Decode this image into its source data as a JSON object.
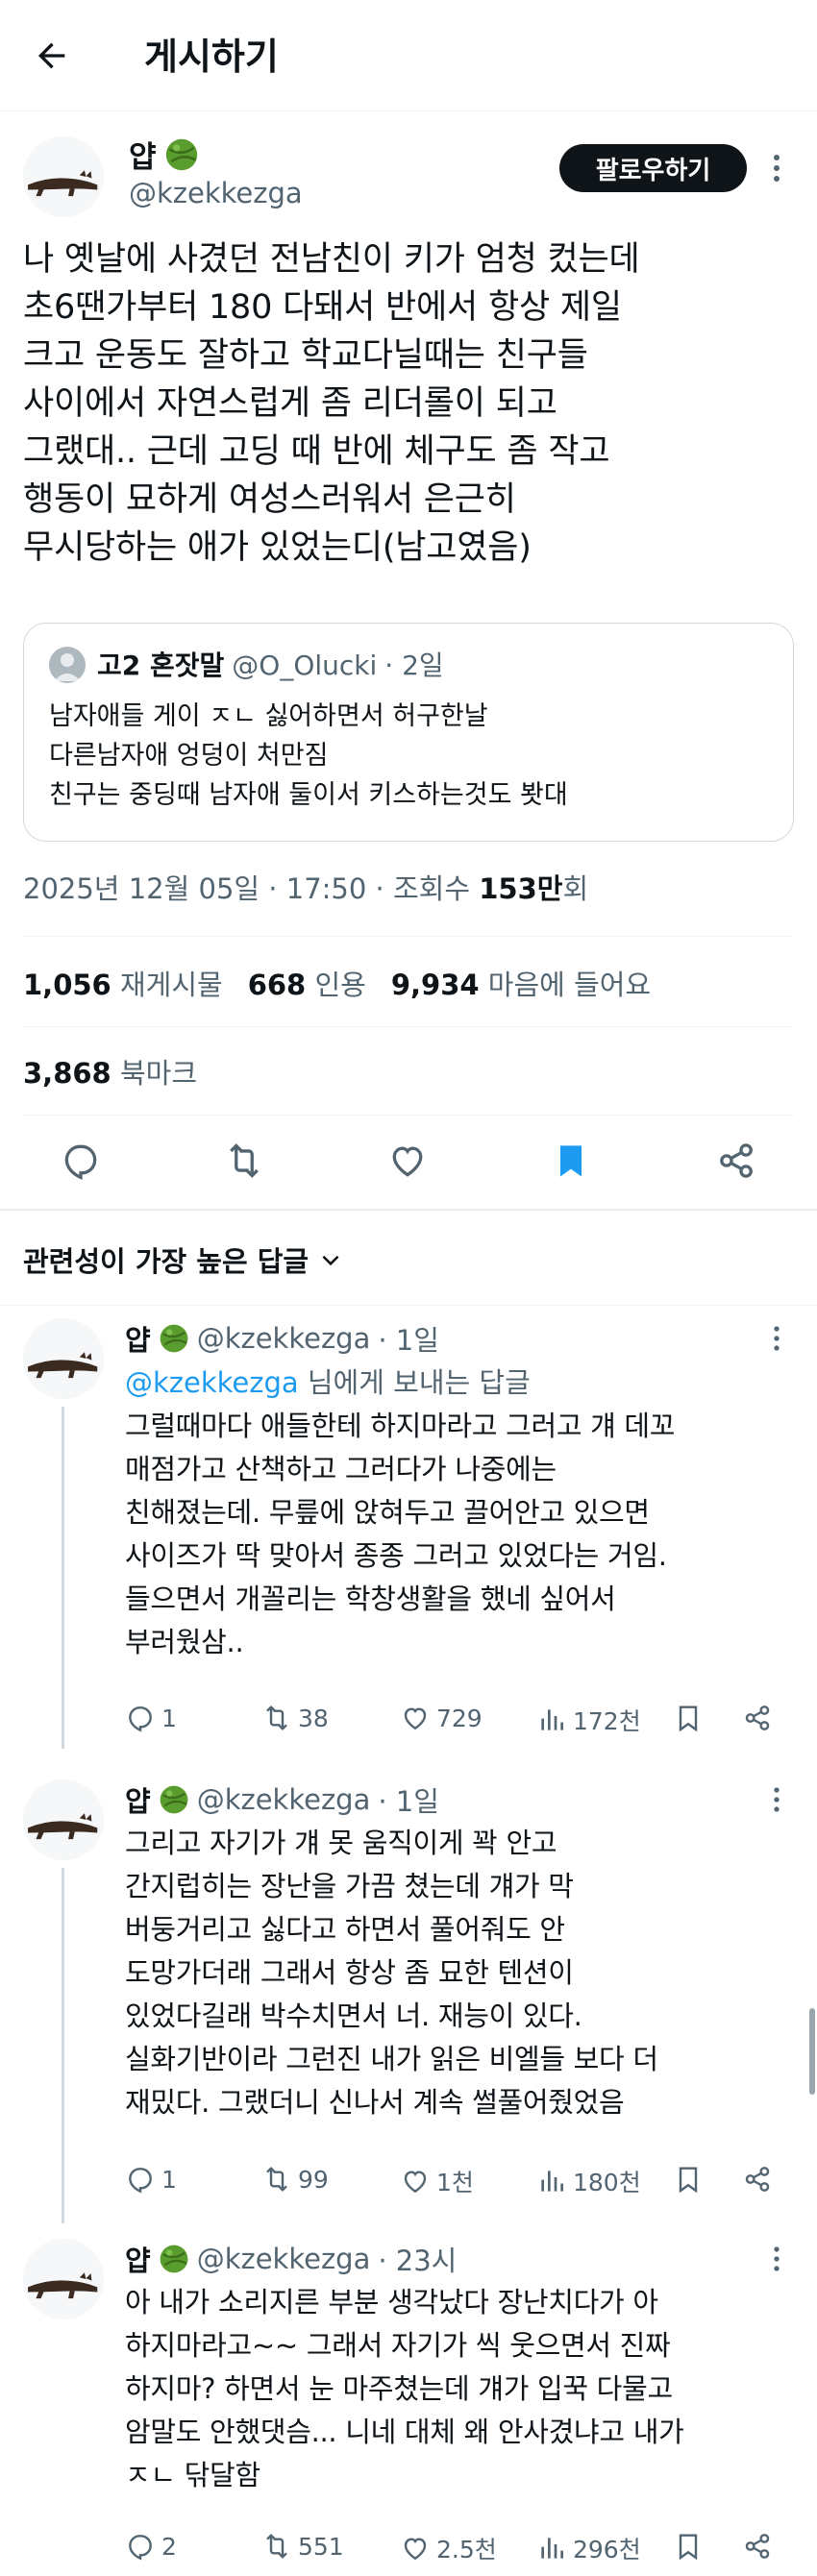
{
  "header": {
    "title": "게시하기"
  },
  "post": {
    "author": {
      "name": "얍",
      "handle": "@kzekkezga"
    },
    "follow_label": "팔로우하기",
    "text": "나 옛날에 사겼던 전남친이 키가 엄청 컸는데\n초6땐가부터 180 다돼서 반에서 항상 제일\n크고 운동도 잘하고 학교다닐때는 친구들\n사이에서 자연스럽게 좀 리더롤이 되고\n그랬대.. 근데 고딩 때 반에 체구도 좀 작고\n행동이 묘하게 여성스러워서 은근히\n무시당하는 애가 있었는디(남고였음)",
    "quote": {
      "author": "고2 혼잣말",
      "handle": "@O_Olucki",
      "time": "· 2일",
      "text": "남자애들 게이 ㅈㄴ 싫어하면서 허구한날\n다른남자애 엉덩이 처만짐\n친구는 중딩때 남자애 둘이서 키스하는것도 봣대"
    },
    "meta": {
      "datetime": "2025년 12월 05일 · 17:50 · 조회수 ",
      "views": "153만",
      "views_suffix": "회"
    },
    "stats": {
      "reposts": "1,056",
      "reposts_label": "재게시물",
      "quotes": "668",
      "quotes_label": "인용",
      "likes": "9,934",
      "likes_label": "마음에 들어요",
      "bookmarks": "3,868",
      "bookmarks_label": "북마크"
    }
  },
  "replies_header": {
    "label": "관련성이 가장 높은 답글"
  },
  "replies": [
    {
      "name": "얍",
      "handle": "@kzekkezga",
      "time": "· 1일",
      "reply_to_handle": "@kzekkezga",
      "reply_to_suffix": " 님에게 보내는 답글",
      "text": "그럴때마다 애들한테 하지마라고 그러고 걔 데꼬\n매점가고 산책하고 그러다가 나중에는\n친해졌는데. 무릎에 앉혀두고 끌어안고 있으면\n사이즈가 딱 맞아서 종종 그러고 있었다는 거임.\n들으면서 개꼴리는 학창생활을 했네 싶어서\n부러웠삼..",
      "replies": "1",
      "reposts": "38",
      "likes": "729",
      "views": "172천"
    },
    {
      "name": "얍",
      "handle": "@kzekkezga",
      "time": "· 1일",
      "text": "그리고 자기가 걔 못 움직이게 꽉 안고\n간지럽히는 장난을 가끔 쳤는데 걔가 막\n버둥거리고 싫다고 하면서 풀어줘도 안\n도망가더래 그래서 항상 좀 묘한 텐션이\n있었다길래 박수치면서 너. 재능이 있다.\n실화기반이라 그런진 내가 읽은 비엘들 보다 더\n재밌다. 그랬더니 신나서 계속 썰풀어줬었음",
      "replies": "1",
      "reposts": "99",
      "likes": "1천",
      "views": "180천"
    },
    {
      "name": "얍",
      "handle": "@kzekkezga",
      "time": "· 23시",
      "text": "아 내가 소리지른 부분 생각났다 장난치다가 아\n하지마라고~~ 그래서 자기가 씩 웃으면서 진짜\n하지마? 하면서 눈 마주쳤는데 걔가 입꾹 다물고\n암말도 안했댓슴... 니네 대체 왜 안사겼냐고 내가\nㅈㄴ 닦달함",
      "replies": "2",
      "reposts": "551",
      "likes": "2.5천",
      "views": "296천"
    }
  ],
  "colors": {
    "accent": "#1d9bf0",
    "text": "#0f1419",
    "muted": "#536471",
    "border": "#cfd9de"
  }
}
